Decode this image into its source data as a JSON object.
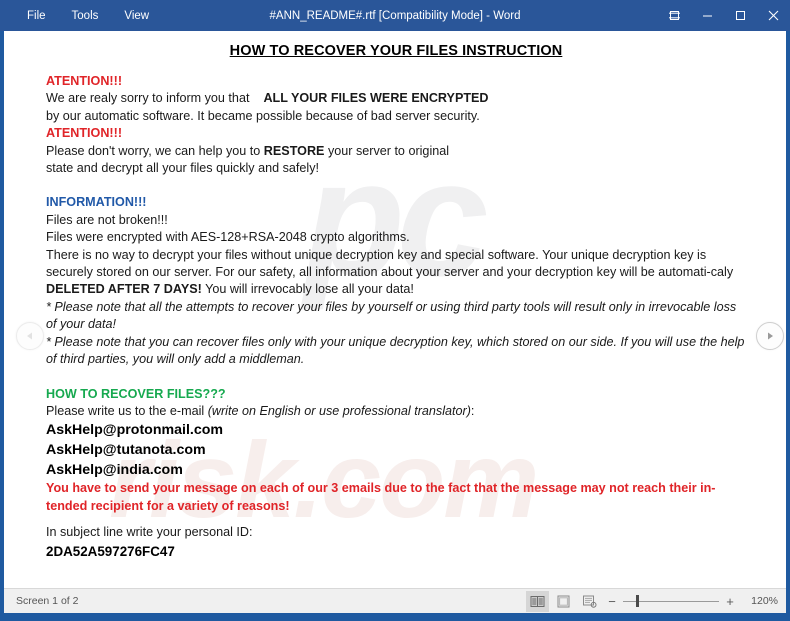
{
  "window": {
    "title": "#ANN_README#.rtf [Compatibility Mode] - Word",
    "titlebar_color": "#2a5699",
    "menus": [
      {
        "label": "File",
        "name": "menu-file"
      },
      {
        "label": "Tools",
        "name": "menu-tools"
      },
      {
        "label": "View",
        "name": "menu-view"
      }
    ],
    "controls": {
      "ribbon_display_options": "ribbon-display-options-icon",
      "minimize": "minimize-icon",
      "maximize": "maximize-icon",
      "close": "close-icon"
    }
  },
  "watermark": {
    "upper": "pc",
    "lower": "risk.com"
  },
  "document": {
    "title": "HOW TO RECOVER YOUR FILES INSTRUCTION",
    "attention_1": "ATENTION!!!",
    "line_1a": "We are realy sorry to inform you that",
    "line_1b": "ALL YOUR FILES WERE ENCRYPTED",
    "line_2": "by our automatic software. It became possible because of bad server security.",
    "attention_2": "ATENTION!!!",
    "line_3a": "Please don't worry, we can help you to ",
    "line_3b": "RESTORE",
    "line_3c": " your server to original",
    "line_4": "state and decrypt all your files quickly and safely!",
    "information_heading": "INFORMATION!!!",
    "info_1": "Files are not broken!!!",
    "info_2": "Files were encrypted with AES-128+RSA-2048 crypto algorithms.",
    "info_3": "There is no way to decrypt your files without unique decryption key and special software. Your unique decryption key is securely stored on our server. For our safety, all information about your server and your decryption key will be automati-caly ",
    "info_3_bold": "DELETED AFTER 7 DAYS!",
    "info_3_tail": " You will irrevocably lose all your data!",
    "note_1": "* Please note that all the attempts to recover your files by yourself or using third party tools will result only in irrevocable loss of your data!",
    "note_2": "* Please note that you can recover files only with your unique decryption key, which stored on our side. If you will use the help of third parties, you will only add a middleman.",
    "recover_heading": "HOW TO RECOVER FILES???",
    "email_intro": "Please write us to the e-mail ",
    "email_intro_italic": "(write on English or use professional translator)",
    "email_intro_tail": ":",
    "emails": [
      "AskHelp@protonmail.com",
      "AskHelp@tutanota.com",
      "AskHelp@india.com"
    ],
    "warning": "You have to send your message on each of our 3 emails due to the fact that the message may not reach their in-tended recipient for a variety of reasons!",
    "subject_line": "In subject line write your personal ID:",
    "personal_id": "2DA52A597276FC47",
    "colors": {
      "red": "#e02428",
      "blue": "#2159a8",
      "green": "#16a94f"
    }
  },
  "navigation": {
    "prev": "previous-screen-arrow",
    "next": "next-screen-arrow"
  },
  "statusbar": {
    "screen_status": "Screen 1 of 2",
    "view_buttons": [
      {
        "name": "read-mode-view-button",
        "active": true
      },
      {
        "name": "print-layout-view-button",
        "active": false
      },
      {
        "name": "web-layout-view-button",
        "active": false
      }
    ],
    "zoom_out": "−",
    "zoom_in": "+",
    "zoom_level": "120%"
  }
}
